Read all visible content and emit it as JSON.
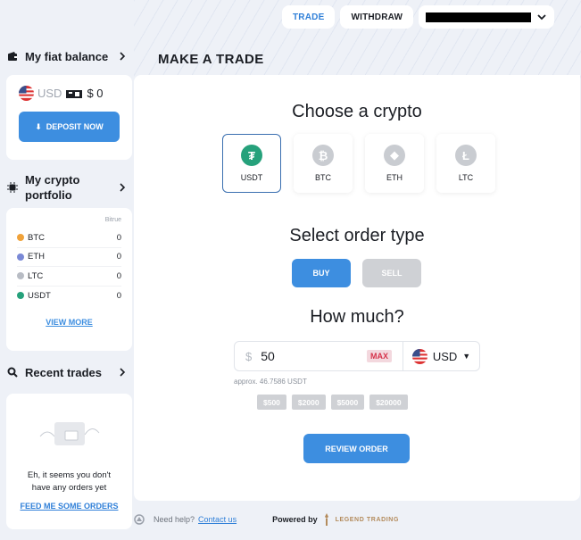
{
  "topnav": {
    "trade": "TRADE",
    "withdraw": "WITHDRAW"
  },
  "sidebar": {
    "fiat_title": "My fiat balance",
    "fiat_currency": "USD",
    "fiat_amount": "$ 0",
    "deposit_label": "DEPOSIT NOW",
    "portfolio_title_line1": "My crypto",
    "portfolio_title_line2": "portfolio",
    "portfolio_source": "Bitrue",
    "portfolio": [
      {
        "symbol": "BTC",
        "amount": "0",
        "color": "#f0a23a"
      },
      {
        "symbol": "ETH",
        "amount": "0",
        "color": "#7a89d6"
      },
      {
        "symbol": "LTC",
        "amount": "0",
        "color": "#b8bcc4"
      },
      {
        "symbol": "USDT",
        "amount": "0",
        "color": "#26a17b"
      }
    ],
    "view_more": "VIEW MORE",
    "recent_title": "Recent trades",
    "recent_empty_line1": "Eh, it seems you don't",
    "recent_empty_line2": "have any orders yet",
    "feed_link": "FEED ME SOME ORDERS"
  },
  "main": {
    "page_title": "MAKE A TRADE",
    "choose_title": "Choose a crypto",
    "coins": [
      {
        "label": "USDT",
        "glyph": "₮",
        "color": "#26a17b"
      },
      {
        "label": "BTC",
        "glyph": "₿",
        "color": "#c9ccd1"
      },
      {
        "label": "ETH",
        "glyph": "◆",
        "color": "#c9ccd1"
      },
      {
        "label": "LTC",
        "glyph": "Ł",
        "color": "#c9ccd1"
      }
    ],
    "order_type_title": "Select order type",
    "buy": "BUY",
    "sell": "SELL",
    "how_much_title": "How much?",
    "amount_symbol": "$",
    "amount_value": "50",
    "max_label": "MAX",
    "currency": "USD",
    "approx": "approx. 46.7586 USDT",
    "presets": [
      "$500",
      "$2000",
      "$5000",
      "$20000"
    ],
    "review": "REVIEW ORDER"
  },
  "footer": {
    "help_text": "Need help?",
    "contact": "Contact us",
    "powered_by": "Powered by",
    "brand": "LEGEND TRADING"
  },
  "colors": {
    "accent": "#3d8ee0",
    "usdt": "#26a17b",
    "danger": "#d6344c"
  }
}
